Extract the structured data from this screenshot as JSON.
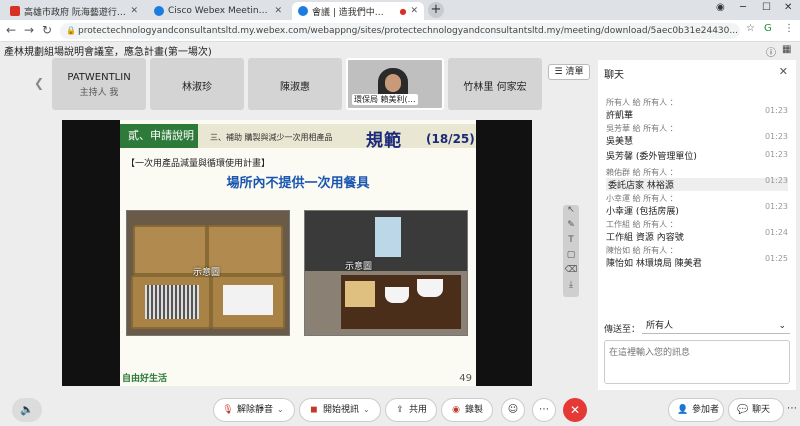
{
  "browser": {
    "tabs": [
      {
        "label": "高雄市政府 阮海藝遊行事會報…",
        "color": "#d93025"
      },
      {
        "label": "Cisco Webex Meetings - Meeti…",
        "color": "#1d7ce0"
      },
      {
        "label": "會議 | 造我們中…",
        "color": "#1d7ce0"
      }
    ],
    "url": "protectechnologyandconsultantsltd.my.webex.com/webappng/sites/protectechnologyandconsultantsltd.my/meeting/download/5aec0b31e24430..."
  },
  "meeting": {
    "title": "產林規劃組場說明會議室，應急計畫(第一場次)",
    "list_label": "清單",
    "participants": [
      {
        "name": "PATWENTLIN",
        "role": "主持人 我"
      },
      {
        "name": "林淑珍",
        "role": ""
      },
      {
        "name": "陳淑惠",
        "role": ""
      },
      {
        "name": "",
        "role": "",
        "caption": "環保局 賴美利(…"
      },
      {
        "name": "竹林里 何家宏",
        "role": ""
      }
    ]
  },
  "slide": {
    "section": "貳、申請說明",
    "subtitle": "三、補助 購製與減少一次用相產品",
    "headline": "規範",
    "page": "(18/25)",
    "category": "【一次用產品減量與循環使用計畫】",
    "message": "場所內不提供一次用餐具",
    "photo1_caption": "示意圖",
    "photo2_caption": "示意圖",
    "logo": "自由好生活",
    "slide_number": "49"
  },
  "chat": {
    "title": "聊天",
    "messages": [
      {
        "from": "所有人 給 所有人 ：",
        "body": "許凱華",
        "time": "01:23"
      },
      {
        "from": "吳芳華 給 所有人 ：",
        "body": "吳美慧",
        "time": "01:23"
      },
      {
        "from": "",
        "body": "吳芳馨 (委外管理單位)",
        "time": "01:23"
      },
      {
        "from": "賴佑群 給 所有人 ：",
        "body": "委託店家 林裕源",
        "time": "01:23"
      },
      {
        "from": "小幸運 給 所有人 ：",
        "body": "小幸運 (包括房展)",
        "time": "01:23"
      },
      {
        "from": "工作組 給 所有人 ：",
        "body": "工作組 資源 內容號",
        "time": "01:24"
      },
      {
        "from": "陳怡如 給 所有人 ：",
        "body": "陳怡如 林環境局 陳美君",
        "time": "01:25"
      }
    ],
    "send_to_label": "傳送至：",
    "send_to_value": "所有人",
    "input_placeholder": "在這裡輸入您的訊息"
  },
  "toolbar": {
    "mute": "解除靜音",
    "video": "開始視訊",
    "share": "共用",
    "record": "錄製",
    "participants": "參加者",
    "chat": "聊天"
  }
}
